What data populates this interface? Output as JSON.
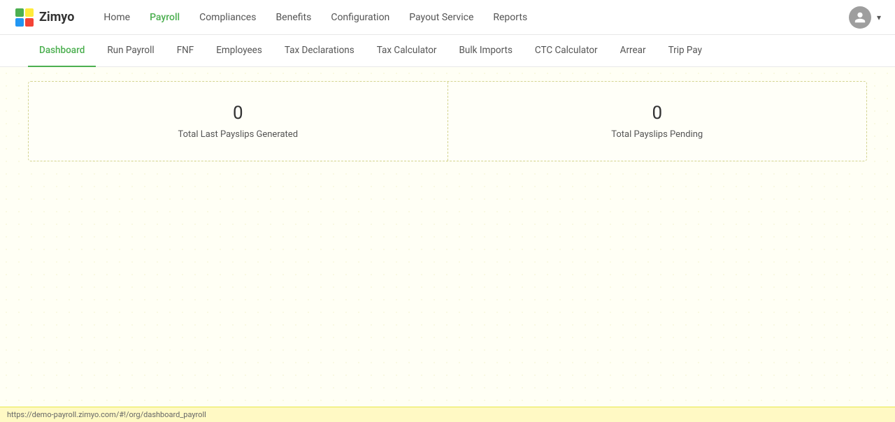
{
  "brand": {
    "name": "Zimyo"
  },
  "navbar": {
    "items": [
      {
        "id": "home",
        "label": "Home",
        "active": false
      },
      {
        "id": "payroll",
        "label": "Payroll",
        "active": true
      },
      {
        "id": "compliances",
        "label": "Compliances",
        "active": false
      },
      {
        "id": "benefits",
        "label": "Benefits",
        "active": false
      },
      {
        "id": "configuration",
        "label": "Configuration",
        "active": false
      },
      {
        "id": "payout-service",
        "label": "Payout Service",
        "active": false
      },
      {
        "id": "reports",
        "label": "Reports",
        "active": false
      }
    ]
  },
  "subtabs": {
    "items": [
      {
        "id": "dashboard",
        "label": "Dashboard",
        "active": true
      },
      {
        "id": "run-payroll",
        "label": "Run Payroll",
        "active": false
      },
      {
        "id": "fnf",
        "label": "FNF",
        "active": false
      },
      {
        "id": "employees",
        "label": "Employees",
        "active": false
      },
      {
        "id": "tax-declarations",
        "label": "Tax Declarations",
        "active": false
      },
      {
        "id": "tax-calculator",
        "label": "Tax Calculator",
        "active": false
      },
      {
        "id": "bulk-imports",
        "label": "Bulk Imports",
        "active": false
      },
      {
        "id": "ctc-calculator",
        "label": "CTC Calculator",
        "active": false
      },
      {
        "id": "arrear",
        "label": "Arrear",
        "active": false
      },
      {
        "id": "trip-pay",
        "label": "Trip Pay",
        "active": false
      }
    ]
  },
  "dashboard": {
    "cards": [
      {
        "id": "total-last-payslips",
        "value": "0",
        "label": "Total Last Payslips Generated"
      },
      {
        "id": "total-payslips-pending",
        "value": "0",
        "label": "Total Payslips Pending"
      }
    ]
  },
  "statusbar": {
    "url": "https://demo-payroll.zimyo.com/#!/org/dashboard_payroll"
  },
  "avatar": {
    "initial": ""
  }
}
